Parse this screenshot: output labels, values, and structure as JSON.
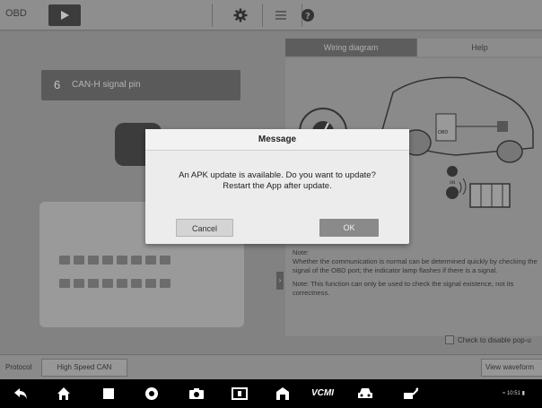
{
  "toolbar": {
    "app_label": "OBD",
    "play_icon": "play-icon",
    "settings_icon": "gear-icon",
    "menu_icon": "list-icon",
    "help_icon": "help-icon"
  },
  "pin": {
    "number": "6",
    "label": "CAN-H signal pin"
  },
  "tabs": {
    "wiring": "Wiring diagram",
    "help": "Help"
  },
  "note": {
    "heading": "Note:",
    "line1": "Whether the communication is normal can be determined quickly by checking the signal of the OBD port; the indicator lamp flashes if there is a signal.",
    "line2": "Note: This function can only be used to check the signal existence, not its correctness."
  },
  "checkbox": {
    "label": "Check to disable pop-u"
  },
  "protocol_bar": {
    "label": "Protocol",
    "value": "High Speed CAN",
    "view_button": "View waveform"
  },
  "dialog": {
    "title": "Message",
    "message_line1": "An APK update is available. Do you want to update?",
    "message_line2": "Restart the App after update.",
    "cancel": "Cancel",
    "ok": "OK"
  },
  "navbar": {
    "vcm_label": "VCMI",
    "status_text": "≈ 10:51 ▮"
  },
  "colors": {
    "dim_overlay": "#7a7a7a",
    "dialog_bg": "#ececec",
    "nav_bg": "#000000"
  }
}
